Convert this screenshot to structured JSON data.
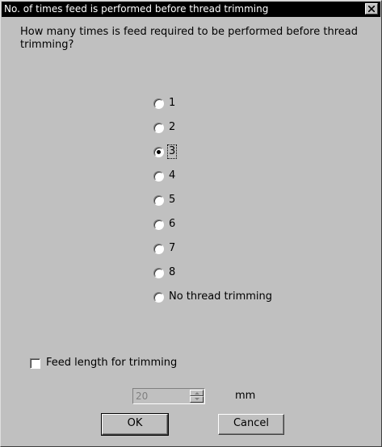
{
  "window": {
    "title": "No. of times feed is performed before thread trimming",
    "close_glyph": "✕"
  },
  "question": "How many times is feed required to be performed before thread trimming?",
  "options": [
    {
      "label": "1",
      "checked": false
    },
    {
      "label": "2",
      "checked": false
    },
    {
      "label": "3",
      "checked": true
    },
    {
      "label": "4",
      "checked": false
    },
    {
      "label": "5",
      "checked": false
    },
    {
      "label": "6",
      "checked": false
    },
    {
      "label": "7",
      "checked": false
    },
    {
      "label": "8",
      "checked": false
    },
    {
      "label": "No thread trimming",
      "checked": false
    }
  ],
  "feed_length": {
    "checkbox_label": "Feed length for trimming",
    "checked": false,
    "value": "20",
    "unit": "mm",
    "enabled": false
  },
  "buttons": {
    "ok": "OK",
    "cancel": "Cancel"
  }
}
